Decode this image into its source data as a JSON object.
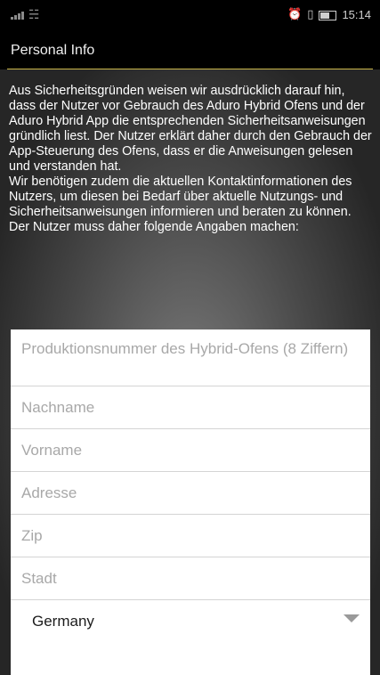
{
  "status_bar": {
    "time": "15:14",
    "icons": [
      "signal-icon",
      "wifi-icon",
      "alarm-icon",
      "vibrate-icon",
      "battery-icon"
    ]
  },
  "header": {
    "title": "Personal Info"
  },
  "intro": "Aus Sicherheitsgründen weisen wir ausdrücklich darauf hin, dass der Nutzer vor Gebrauch des Aduro Hybrid Ofens und der Aduro Hybrid App die entsprechenden Sicherheitsanweisungen gründlich liest. Der Nutzer erklärt daher durch den Gebrauch der App-Steuerung des Ofens, dass er die Anweisungen gelesen und verstanden hat.\nWir benötigen zudem die aktuellen Kontaktinformationen des Nutzers, um diesen bei Bedarf über aktuelle Nutzungs- und Sicherheitsanweisungen informieren und beraten zu können.\nDer Nutzer muss daher folgende Angaben machen:",
  "form": {
    "production_number_placeholder": "Produktionsnummer des Hybrid-Ofens (8 Ziffern)",
    "lastname_placeholder": "Nachname",
    "firstname_placeholder": "Vorname",
    "address_placeholder": "Adresse",
    "zip_placeholder": "Zip",
    "city_placeholder": "Stadt",
    "country_value": "Germany"
  }
}
